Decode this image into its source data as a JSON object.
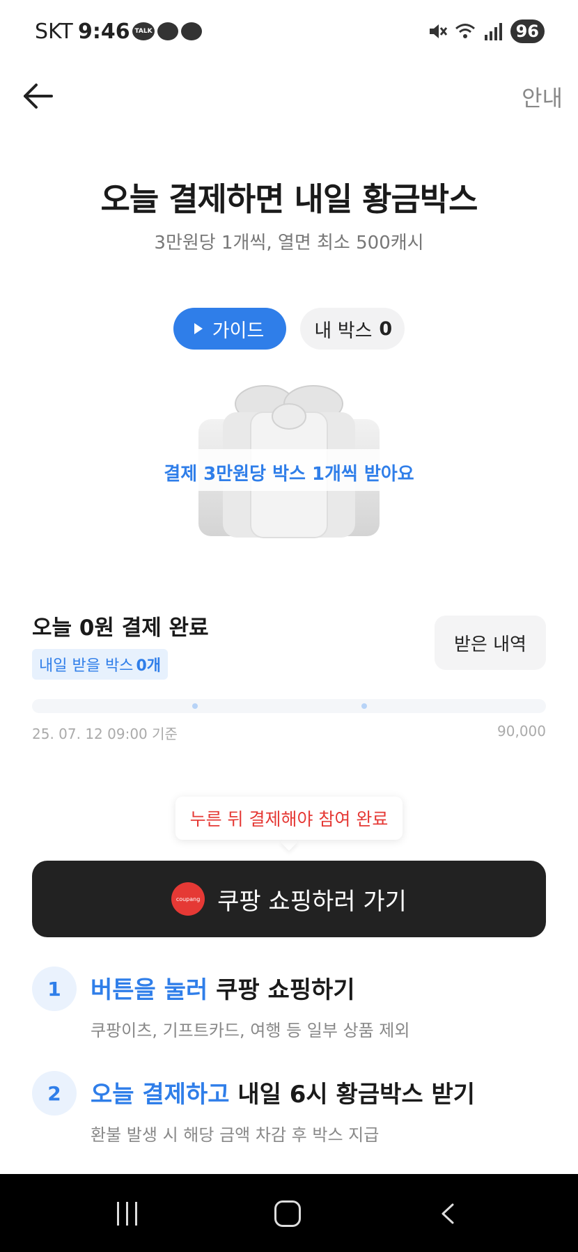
{
  "status_bar": {
    "carrier": "SKT",
    "time": "9:46",
    "talk_label": "TALK",
    "battery": "96"
  },
  "header": {
    "guide_link": "안내"
  },
  "hero": {
    "title": "오늘 결제하면 내일 황금박스",
    "subtitle": "3만원당 1개씩, 열면 최소 500캐시"
  },
  "chips": {
    "guide_label": "가이드",
    "my_box_label": "내 박스",
    "my_box_count": "0"
  },
  "gift": {
    "caption": "결제 3만원당 박스 1개씩 받아요"
  },
  "progress": {
    "today_status": "오늘 0원 결제 완료",
    "tomorrow_prefix": "내일 받을 박스",
    "tomorrow_count": "0개",
    "history_button": "받은 내역",
    "as_of": "25. 07. 12 09:00 기준",
    "max_amount": "90,000"
  },
  "tooltip": {
    "text": "누른 뒤 결제해야 참여 완료"
  },
  "cta": {
    "badge_text": "coupang",
    "label": "쿠팡 쇼핑하러 가기"
  },
  "steps": [
    {
      "num": "1",
      "accent": "버튼을 눌러",
      "title": " 쿠팡 쇼핑하기",
      "desc": "쿠팡이츠, 기프트카드, 여행 등 일부 상품 제외"
    },
    {
      "num": "2",
      "accent": "오늘 결제하고",
      "title": " 내일 6시 황금박스 받기",
      "desc": "환불 발생 시 해당 금액 차감 후 박스 지급"
    }
  ],
  "colors": {
    "accent_blue": "#2f7ee9",
    "tooltip_red": "#e53935",
    "cta_dark": "#222222"
  }
}
